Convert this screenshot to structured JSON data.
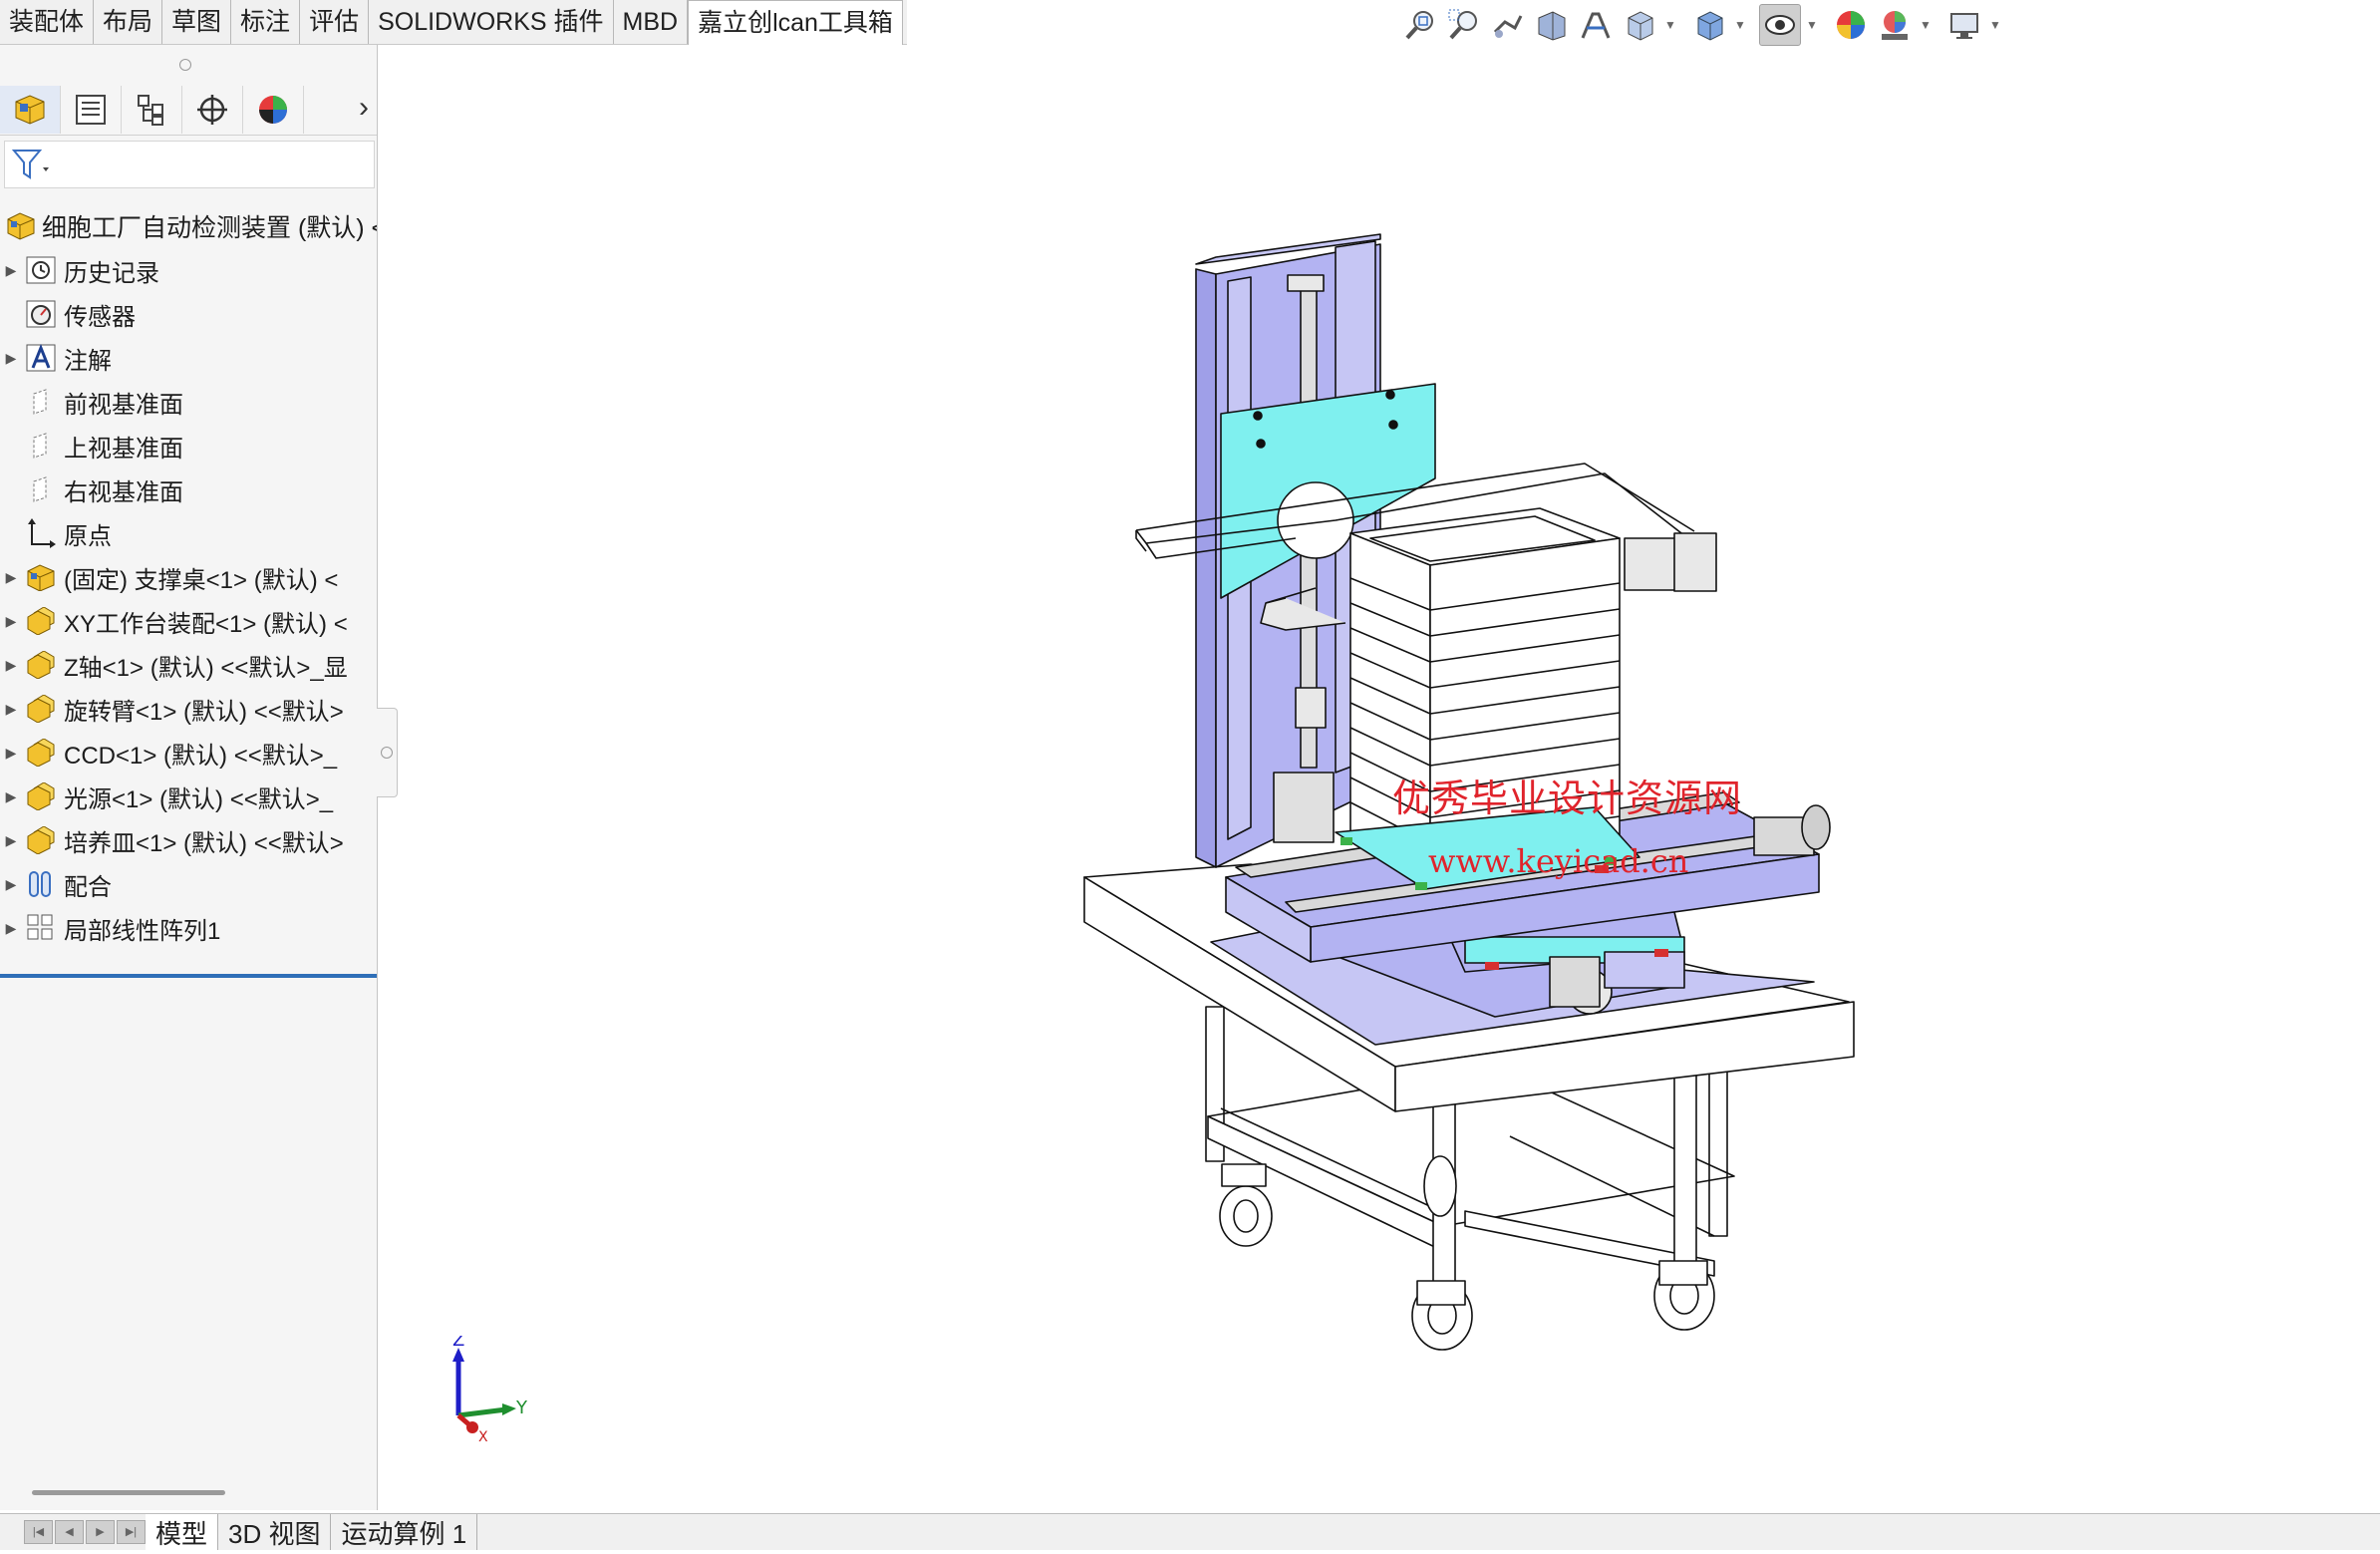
{
  "command_tabs": [
    "装配体",
    "布局",
    "草图",
    "标注",
    "评估",
    "SOLIDWORKS 插件",
    "MBD",
    "嘉立创lcan工具箱"
  ],
  "view_toolbar": {
    "icons": [
      "zoom-to-fit-icon",
      "zoom-to-area-icon",
      "previous-view-icon",
      "section-view-icon",
      "dynamic-annotation-icon",
      "view-orientation-icon",
      "display-style-icon",
      "hide-show-items-icon",
      "edit-appearance-icon",
      "apply-scene-icon",
      "view-settings-icon"
    ]
  },
  "feature_manager": {
    "tab_icons": [
      "featuremanager-tree-icon",
      "propertymanager-icon",
      "configurationmanager-icon",
      "dimxpert-icon",
      "display-manager-icon"
    ],
    "more_glyph": "›",
    "filter_icon": "filter-icon",
    "root": "细胞工厂自动检测装置 (默认) <",
    "items": [
      {
        "label": "历史记录",
        "icon": "history-icon",
        "expandable": true
      },
      {
        "label": "传感器",
        "icon": "sensor-icon",
        "expandable": false
      },
      {
        "label": "注解",
        "icon": "annotation-icon",
        "expandable": true
      },
      {
        "label": "前视基准面",
        "icon": "plane-icon",
        "expandable": false
      },
      {
        "label": "上视基准面",
        "icon": "plane-icon",
        "expandable": false
      },
      {
        "label": "右视基准面",
        "icon": "plane-icon",
        "expandable": false
      },
      {
        "label": "原点",
        "icon": "origin-icon",
        "expandable": false
      },
      {
        "label": "(固定) 支撑桌<1> (默认) <",
        "icon": "part-icon",
        "expandable": true
      },
      {
        "label": "XY工作台装配<1> (默认) <",
        "icon": "subassembly-icon",
        "expandable": true
      },
      {
        "label": "Z轴<1> (默认) <<默认>_显",
        "icon": "subassembly-icon",
        "expandable": true
      },
      {
        "label": "旋转臂<1> (默认) <<默认>",
        "icon": "subassembly-icon",
        "expandable": true
      },
      {
        "label": "CCD<1> (默认) <<默认>_",
        "icon": "subassembly-icon",
        "expandable": true
      },
      {
        "label": "光源<1> (默认) <<默认>_",
        "icon": "subassembly-icon",
        "expandable": true
      },
      {
        "label": "培养皿<1> (默认) <<默认>",
        "icon": "subassembly-icon",
        "expandable": true
      },
      {
        "label": "配合",
        "icon": "mates-icon",
        "expandable": true
      },
      {
        "label": "局部线性阵列1",
        "icon": "linear-pattern-icon",
        "expandable": true
      }
    ]
  },
  "bottom_tabs": [
    "模型",
    "3D 视图",
    "运动算例 1"
  ],
  "nav_buttons": [
    "|◀",
    "◀",
    "▶",
    "▶|"
  ],
  "watermark": {
    "line1": "优秀毕业设计资源网",
    "line2": "www.keyicad.cn"
  },
  "triad": {
    "z": "Z",
    "y": "Y",
    "x": "X"
  },
  "colors": {
    "machine_blue": "#b3b3f2",
    "plate_cyan": "#7ff0ef",
    "watermark_red": "#e0242c",
    "tree_end_line": "#2f6fb8"
  }
}
